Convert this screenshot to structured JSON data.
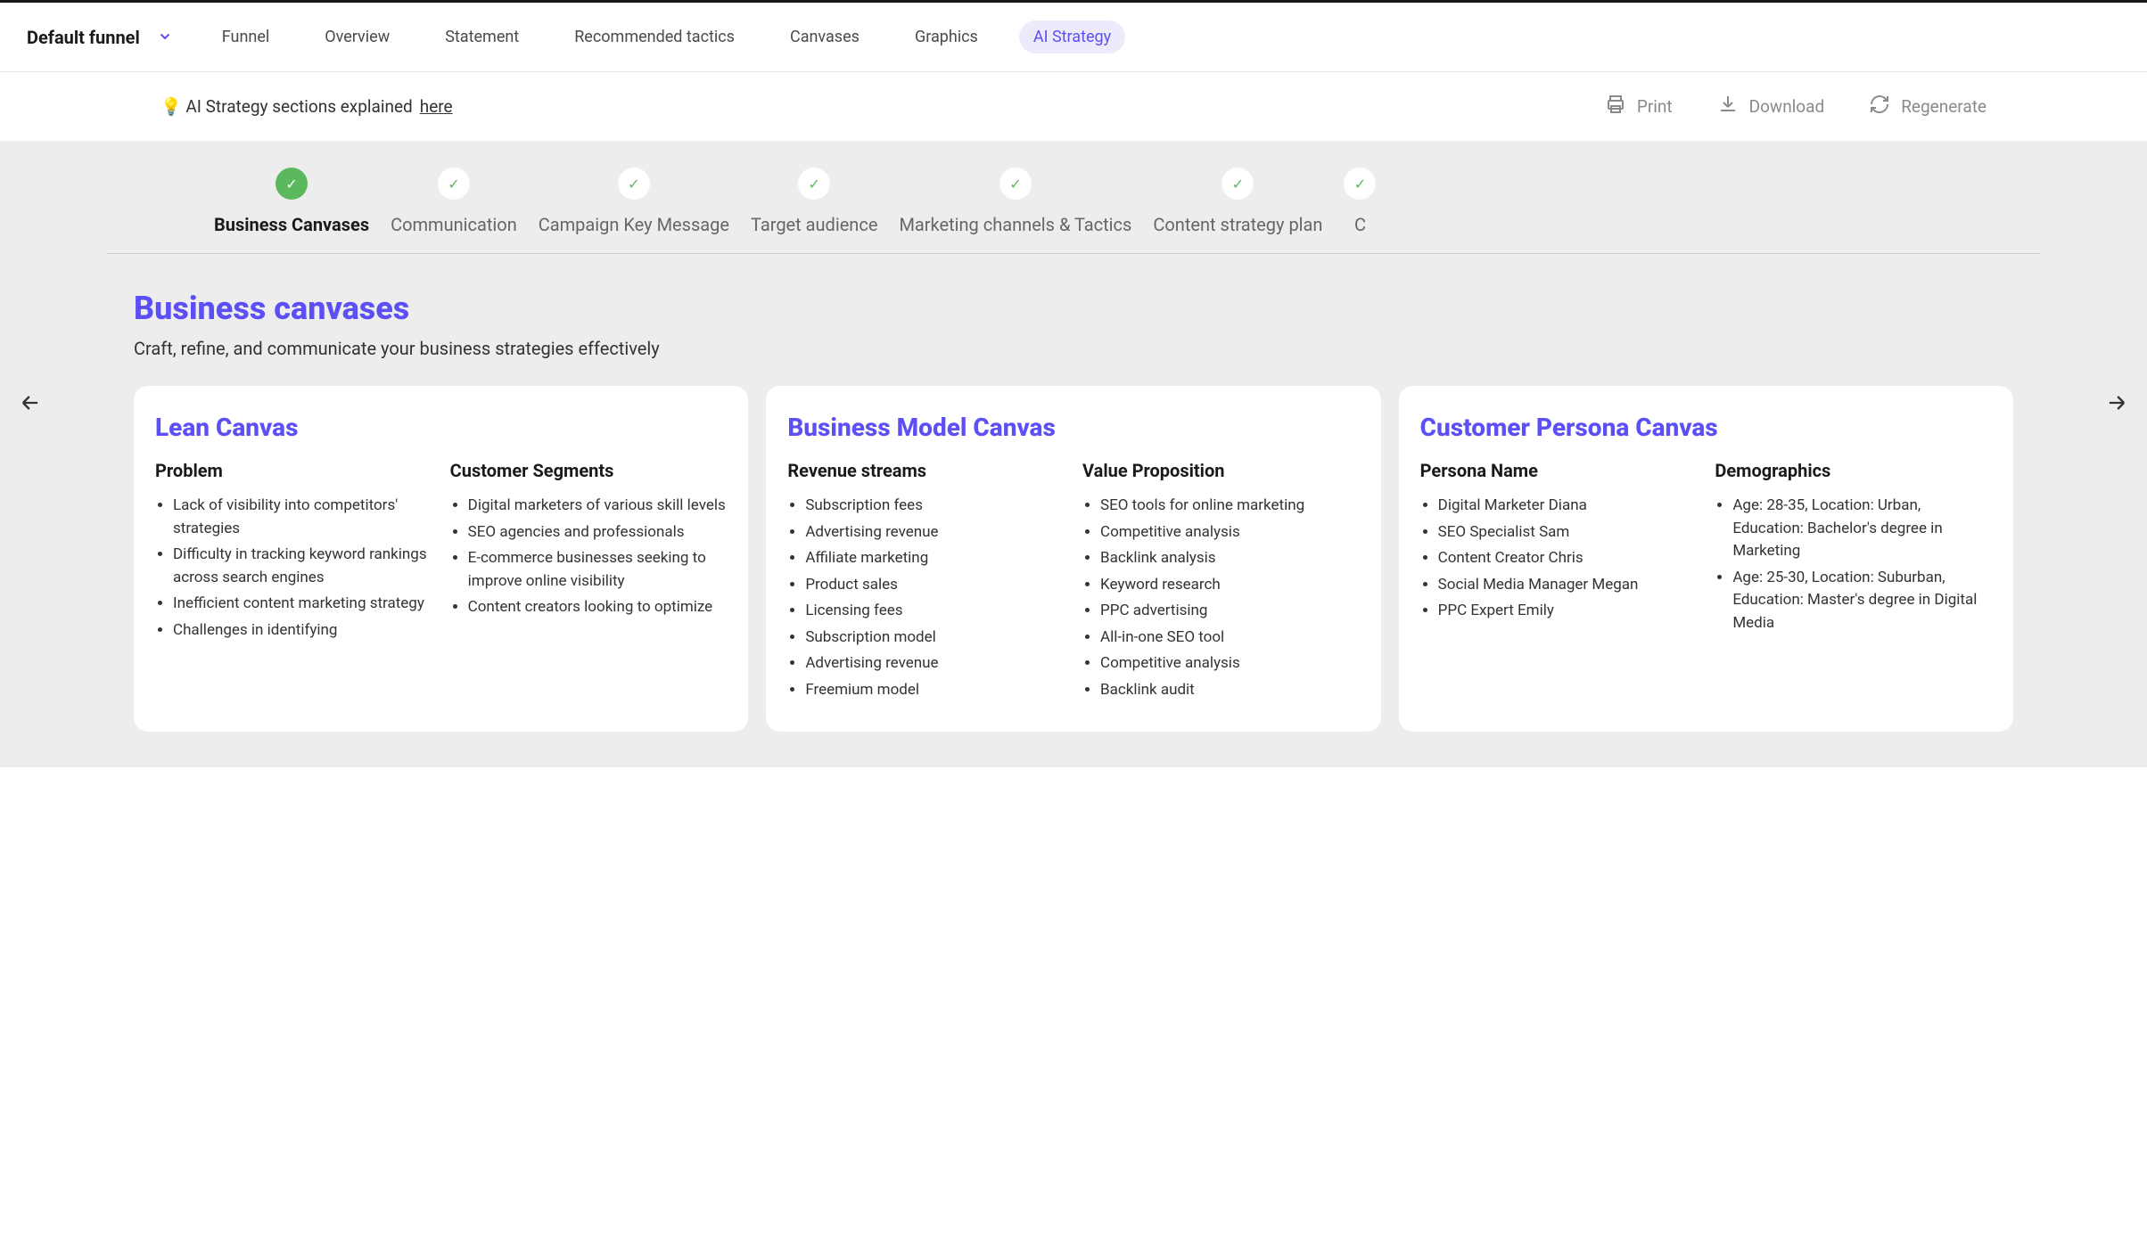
{
  "header": {
    "funnel_name": "Default funnel",
    "tabs": [
      "Funnel",
      "Overview",
      "Statement",
      "Recommended tactics",
      "Canvases",
      "Graphics",
      "AI Strategy"
    ],
    "active_tab": 6
  },
  "toolbar": {
    "tip_prefix": "💡 AI Strategy sections explained ",
    "tip_link": "here",
    "print": "Print",
    "download": "Download",
    "regenerate": "Regenerate"
  },
  "progress": {
    "items": [
      "Business Canvases",
      "Communication",
      "Campaign Key Message",
      "Target audience",
      "Marketing channels & Tactics",
      "Content strategy plan",
      "C"
    ],
    "active": 0
  },
  "section": {
    "title": "Business canvases",
    "subtitle": "Craft, refine, and communicate your business strategies effectively"
  },
  "cards": [
    {
      "title": "Lean Canvas",
      "cols": [
        {
          "heading": "Problem",
          "items": [
            "Lack of visibility into competitors' strategies",
            "Difficulty in tracking keyword rankings across search engines",
            "Inefficient content marketing strategy",
            "Challenges in identifying"
          ]
        },
        {
          "heading": "Customer Segments",
          "items": [
            "Digital marketers of various skill levels",
            "SEO agencies and professionals",
            "E-commerce businesses seeking to improve online visibility",
            "Content creators looking to optimize"
          ]
        }
      ]
    },
    {
      "title": "Business Model Canvas",
      "cols": [
        {
          "heading": "Revenue streams",
          "items": [
            "Subscription fees",
            "Advertising revenue",
            "Affiliate marketing",
            "Product sales",
            "Licensing fees",
            "Subscription model",
            "Advertising revenue",
            "Freemium model"
          ]
        },
        {
          "heading": "Value Proposition",
          "items": [
            "SEO tools for online marketing",
            "Competitive analysis",
            "Backlink analysis",
            "Keyword research",
            "PPC advertising",
            "All-in-one SEO tool",
            "Competitive analysis",
            "Backlink audit"
          ]
        }
      ]
    },
    {
      "title": "Customer Persona Canvas",
      "cols": [
        {
          "heading": "Persona Name",
          "items": [
            "Digital Marketer Diana",
            "SEO Specialist Sam",
            "Content Creator Chris",
            "Social Media Manager Megan",
            "PPC Expert Emily"
          ]
        },
        {
          "heading": "Demographics",
          "items": [
            "Age: 28-35, Location: Urban, Education: Bachelor's degree in Marketing",
            "Age: 25-30, Location: Suburban, Education: Master's degree in Digital Media"
          ]
        }
      ]
    }
  ]
}
